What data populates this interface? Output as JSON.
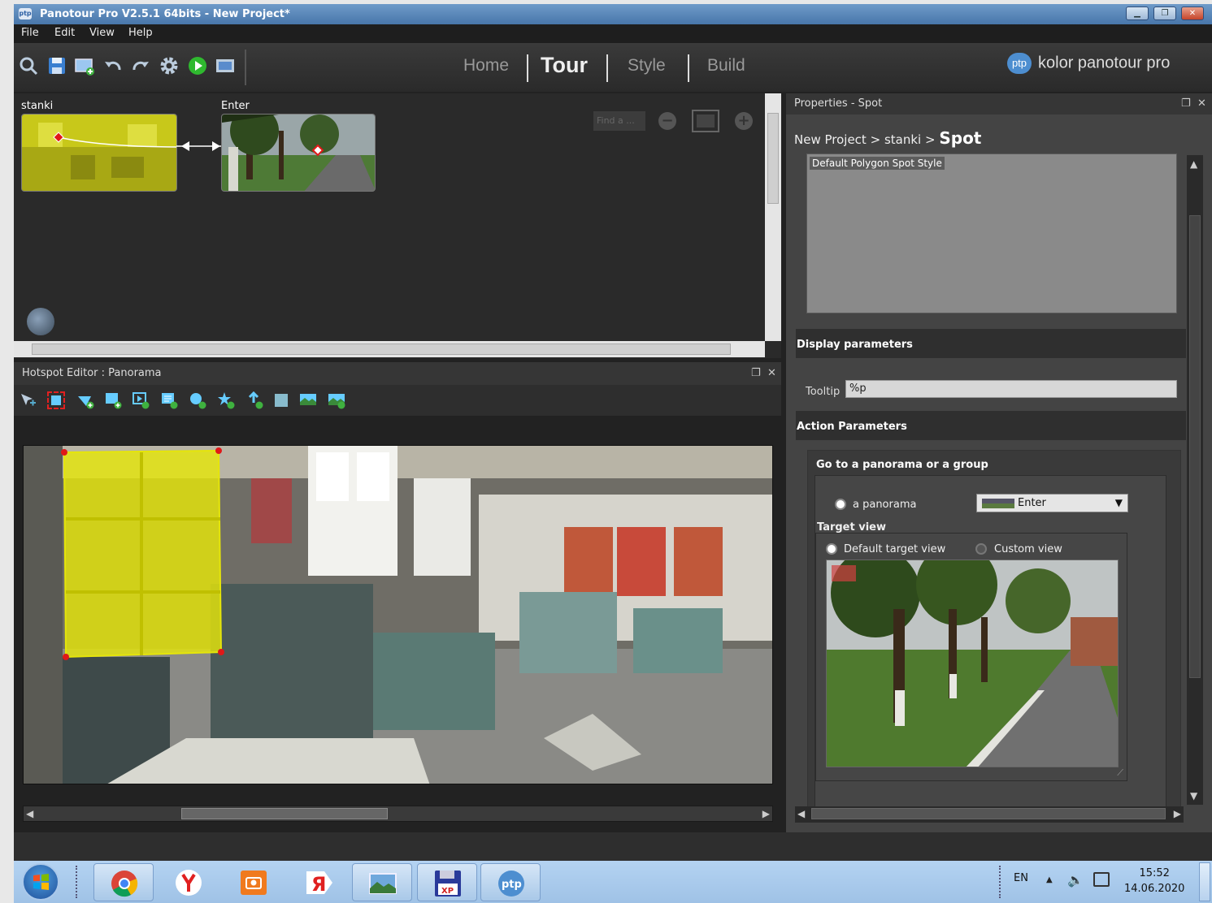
{
  "window": {
    "title": "Panotour Pro V2.5.1 64bits - New Project*"
  },
  "menu": [
    "File",
    "Edit",
    "View",
    "Help"
  ],
  "toolbar": {
    "icons": [
      "search-tour-icon",
      "save-icon",
      "add-panorama-icon",
      "undo-icon",
      "redo-icon",
      "settings-icon",
      "play-icon",
      "publish-icon"
    ]
  },
  "nav": {
    "tabs": [
      "Home",
      "Tour",
      "Style",
      "Build"
    ],
    "active": "Tour"
  },
  "brand": {
    "logo": "ptp",
    "text": "kolor panotour pro"
  },
  "tour_graph": {
    "nodes": [
      {
        "label": "stanki"
      },
      {
        "label": "Enter"
      }
    ],
    "find_placeholder": "Find a ..."
  },
  "hotspot_editor": {
    "title": "Hotspot Editor : Panorama"
  },
  "properties": {
    "title": "Properties - Spot",
    "breadcrumb": {
      "parts": [
        "New Project",
        ">",
        "stanki",
        ">"
      ],
      "current": "Spot"
    },
    "style_item": "Default Polygon Spot Style",
    "display_section": "Display parameters",
    "tooltip_label": "Tooltip",
    "tooltip_value": "%p",
    "action_section": "Action Parameters",
    "goto_title": "Go to a panorama or a group",
    "radio_panorama": "a panorama",
    "panorama_select": "Enter",
    "target_view_label": "Target view",
    "radio_default": "Default target view",
    "radio_custom": "Custom view"
  },
  "taskbar": {
    "apps": [
      "chrome",
      "yandex-browser",
      "screenshot-tool",
      "yandex",
      "image-viewer",
      "xp-floppy",
      "panotour"
    ],
    "lang": "EN",
    "time": "15:52",
    "date": "14.06.2020"
  },
  "colors": {
    "accent_yellow": "#e5e50a",
    "panel_dark": "#2a2a2a",
    "titlebar": "#4876aa"
  }
}
